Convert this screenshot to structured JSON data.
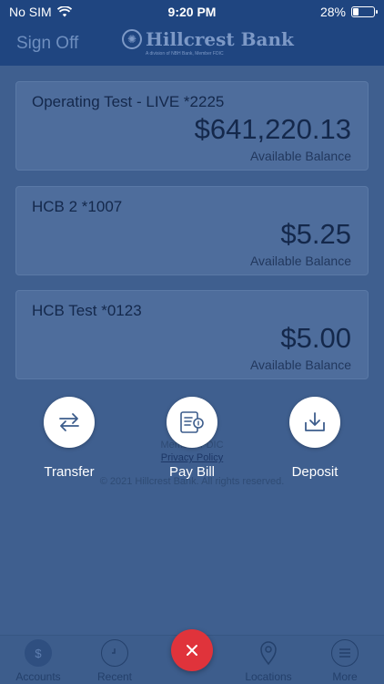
{
  "status_bar": {
    "carrier": "No SIM",
    "time": "9:20 PM",
    "battery": "28%",
    "battery_level": 0.28
  },
  "header": {
    "sign_off": "Sign Off",
    "bank_name": "Hillcrest Bank",
    "bank_tagline": "A division of NBH Bank, Member FDIC"
  },
  "accounts": [
    {
      "name": "Operating Test - LIVE *2225",
      "amount": "$641,220.13",
      "label": "Available Balance"
    },
    {
      "name": "HCB 2 *1007",
      "amount": "$5.25",
      "label": "Available Balance"
    },
    {
      "name": "HCB Test *0123",
      "amount": "$5.00",
      "label": "Available Balance"
    }
  ],
  "footer": {
    "member": "Member FDIC",
    "privacy": "Privacy Policy",
    "copyright": "© 2021 Hillcrest Bank. All rights reserved."
  },
  "actions": {
    "transfer": "Transfer",
    "pay_bill": "Pay Bill",
    "deposit": "Deposit"
  },
  "tabs": {
    "accounts": "Accounts",
    "recent": "Recent",
    "locations": "Locations",
    "more": "More"
  },
  "colors": {
    "header": "#1f4580",
    "overlay": "#3f5f8f",
    "close": "#e0333b"
  }
}
